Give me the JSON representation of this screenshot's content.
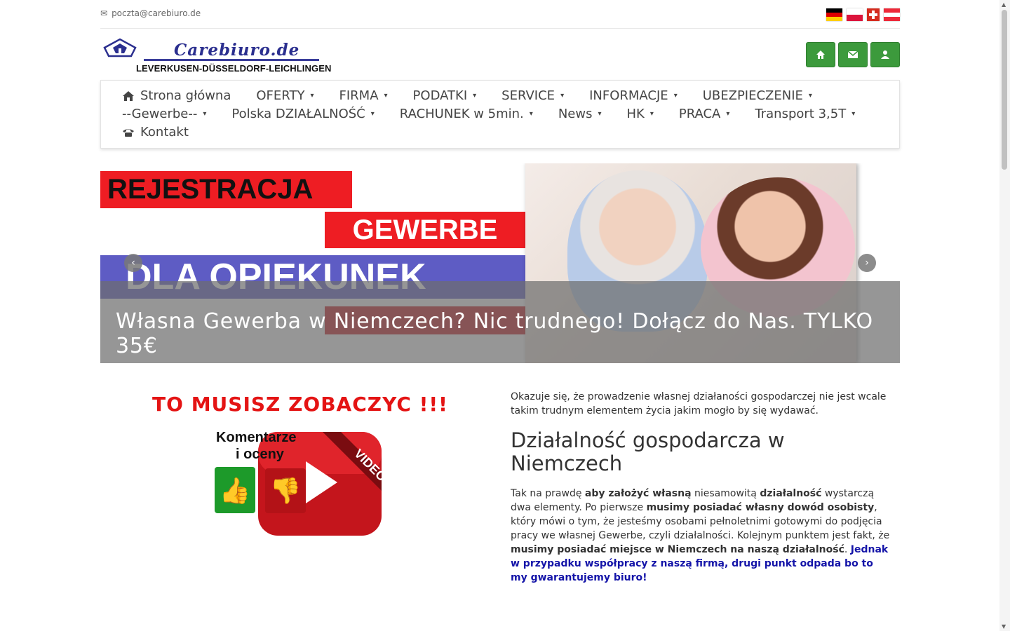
{
  "topbar": {
    "email": "poczta@carebiuro.de",
    "flags": [
      "de",
      "pl",
      "ch",
      "at"
    ]
  },
  "logo": {
    "title": "Carebiuro.de",
    "subtitle": "LEVERKUSEN-DÜSSELDORF-LEICHLINGEN"
  },
  "header_buttons": [
    "home-icon",
    "envelope-icon",
    "user-icon"
  ],
  "nav": {
    "row1": [
      "Strona główna",
      "OFERTY",
      "FIRMA",
      "PODATKI",
      "SERVICE",
      "INFORMACJE",
      "UBEZPIECZENIE"
    ],
    "row2": [
      "--Gewerbe--",
      "Polska DZIAŁALNOŚĆ",
      "RACHUNEK w 5min.",
      "News",
      "HK",
      "PRACA",
      "Transport 3,5T"
    ],
    "row3": [
      "Kontakt"
    ]
  },
  "slider": {
    "banner1": "REJESTRACJA",
    "banner2": "GEWERBE",
    "banner3": "DLA OPIEKUNEK",
    "caption": "Własna Gewerba w Niemczech? Nic trudnego! Dołącz do Nas. TYLKO 35€"
  },
  "left": {
    "heading": "TO MUSISZ ZOBACZYC !!!",
    "video_title1": "Komentarze",
    "video_title2": "i oceny",
    "video_tag": "VIDEO"
  },
  "right": {
    "intro": "Okazuje się, że prowadzenie własnej działaności gospodarczej nie jest wcale takim trudnym elementem życia jakim mogło by się wydawać.",
    "h2": "Działalność gospodarcza w Niemczech",
    "p1": "Tak na prawdę",
    "p2": "aby założyć własną",
    "p3": "niesamowitą",
    "p4": "działalność",
    "p5": "wystarczą dwa elementy. Po pierwsze",
    "p6": "musimy posiadać własny dowód osobisty",
    "p7": ", który mówi o tym, że jesteśmy osobami pełnoletnimi gotowymi do podjęcia pracy we własnej Gewerbe, czyli działalności. Kolejnym punktem jest fakt, że",
    "p8": "musimy posiadać miejsce w Niemczech na naszą działalność",
    "p9": ".",
    "p10": "Jednak w przypadku współpracy z naszą firmą, drugi punkt odpada bo to my gwarantujemy biuro!"
  }
}
